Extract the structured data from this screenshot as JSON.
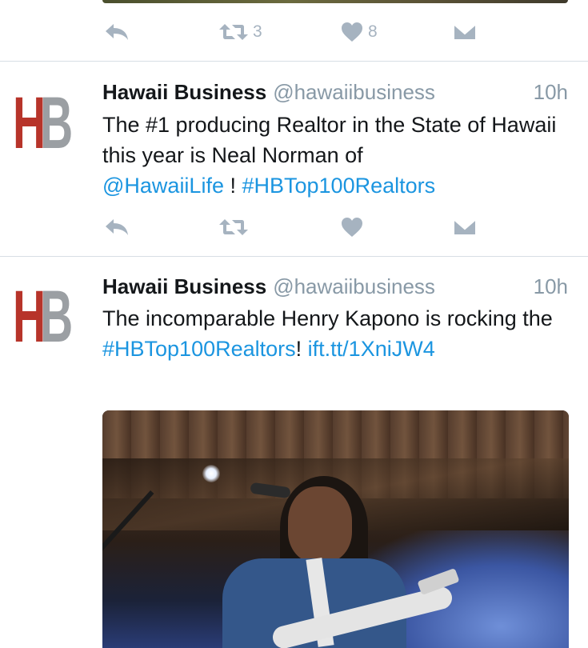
{
  "tweets": [
    {
      "actions": {
        "reply_icon": "reply-icon",
        "retweet_count": "3",
        "like_count": "8",
        "dm_icon": "envelope-icon"
      }
    },
    {
      "avatar": {
        "letter_1": "H",
        "letter_2": "B",
        "colors": {
          "h": "#b7342a",
          "b": "#9b9fa3"
        }
      },
      "name": "Hawaii Business",
      "handle": "@hawaiibusiness",
      "time": "10h",
      "text_1": "The #1 producing Realtor in the State of Hawaii this year is Neal Norman of",
      "link_1": "@HawaiiLife",
      "text_2": " ! ",
      "link_2": "#HBTop100Realtors",
      "actions": {
        "retweet_count": "",
        "like_count": ""
      }
    },
    {
      "avatar": {
        "letter_1": "H",
        "letter_2": "B"
      },
      "name": "Hawaii Business",
      "handle": "@hawaiibusiness",
      "time": "10h",
      "text_1": "The incomparable Henry Kapono is rocking the ",
      "link_1": "#HBTop100Realtors",
      "text_2": "! ",
      "link_2": "ift.tt/​1XniJW4"
    }
  ],
  "colors": {
    "link": "#1b95e0",
    "icon": "#a6b3c0",
    "secondary_text": "#8899a6",
    "divider": "#d7dee4"
  }
}
